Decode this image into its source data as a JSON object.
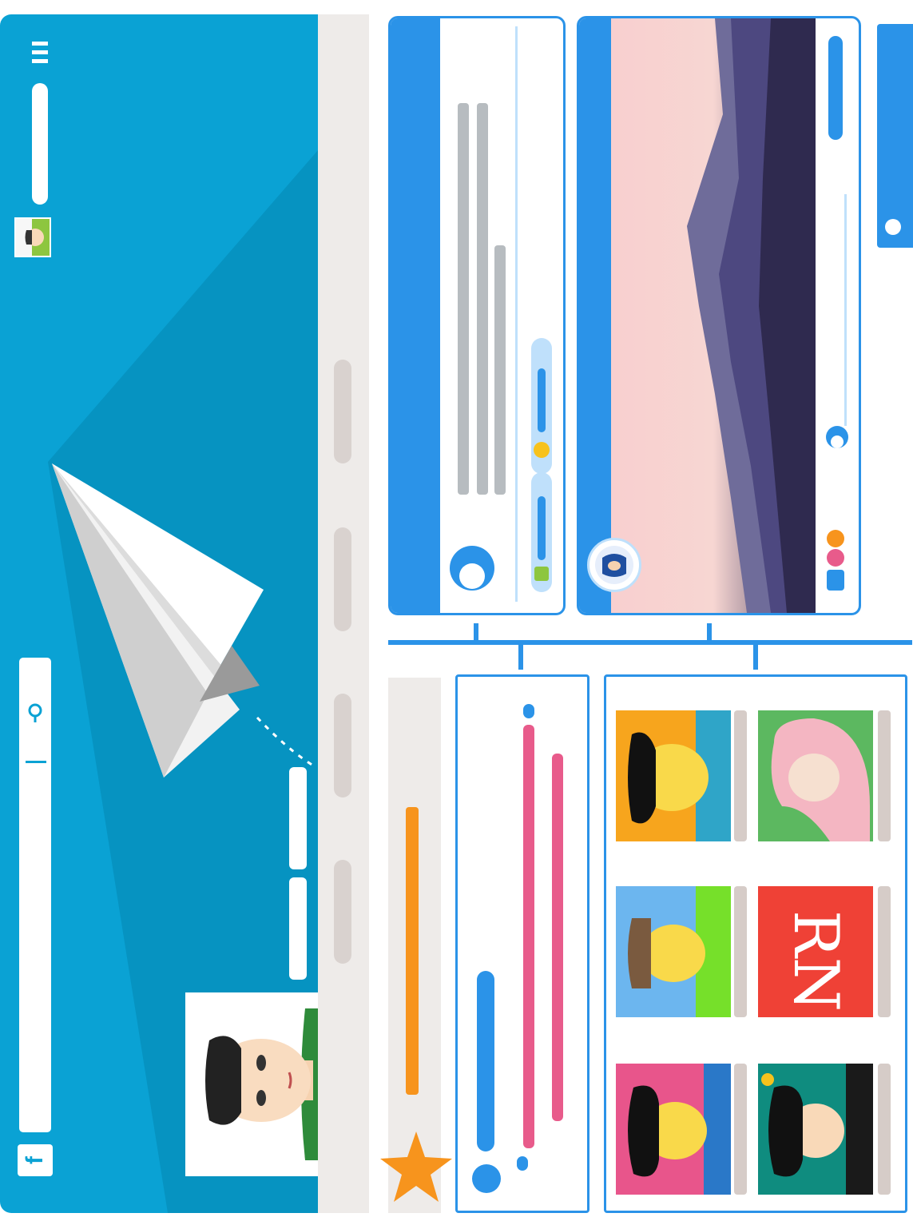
{
  "app": {
    "logo_letter": "f",
    "menu_icon": "hamburger-icon",
    "search_icon": "search-icon"
  },
  "cover": {
    "color": "#0aa2d4",
    "shadow_color": "#0693c1"
  },
  "friends_tile": {
    "letters": "RN"
  },
  "colors": {
    "accent_blue": "#2b93e8",
    "orange": "#f7941d",
    "pink": "#e85b8b",
    "light_gray": "#eeebe9"
  }
}
